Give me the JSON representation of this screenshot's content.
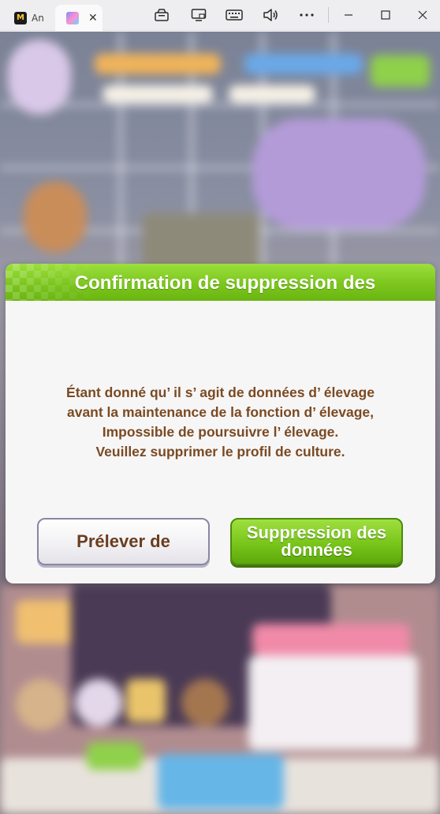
{
  "browser": {
    "tabs": [
      {
        "icon": "app-logo-icon",
        "label": "An"
      },
      {
        "icon": "game-favicon-icon",
        "label": ""
      }
    ],
    "tab_close_glyph": "✕",
    "toolbar_icons": [
      "screenshot-icon",
      "screen-cast-icon",
      "keyboard-icon",
      "volume-icon",
      "more-icon"
    ],
    "window_controls": [
      "minimize-icon",
      "maximize-icon",
      "close-icon"
    ]
  },
  "dialog": {
    "title": "Confirmation de suppression des",
    "message_lines": [
      "Étant donné qu’ il s’ agit de données d’ élevage",
      "avant la maintenance de la fonction d’ élevage,",
      "Impossible de poursuivre l’ élevage.",
      "Veuillez supprimer le profil de culture."
    ],
    "cancel_label": "Prélever de",
    "confirm_label_lines": [
      "Suppression des",
      "données"
    ]
  },
  "colors": {
    "header_green": "#7cc61e",
    "message_brown": "#7a4a22",
    "cancel_text": "#6a3d1e"
  }
}
